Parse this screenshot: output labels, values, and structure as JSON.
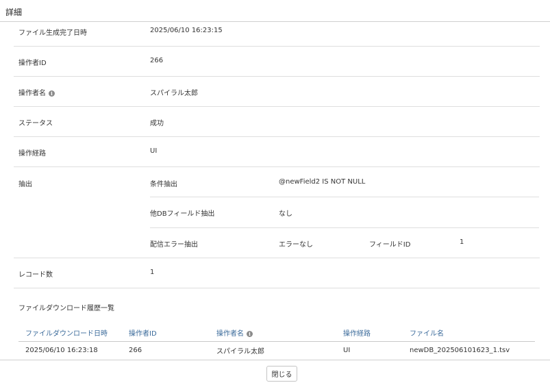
{
  "header": {
    "title": "詳細"
  },
  "details": {
    "file_generated": {
      "label": "ファイル生成完了日時",
      "value": "2025/06/10 16:23:15"
    },
    "operator_id": {
      "label": "操作者ID",
      "value": "266"
    },
    "operator_name": {
      "label": "操作者名",
      "value": "スパイラル太郎",
      "icon": "info-icon"
    },
    "status": {
      "label": "ステータス",
      "value": "成功"
    },
    "route": {
      "label": "操作経路",
      "value": "UI"
    },
    "extraction": {
      "label": "抽出",
      "condition": {
        "label": "条件抽出",
        "value": "@newField2 IS NOT NULL"
      },
      "other_db": {
        "label": "他DBフィールド抽出",
        "value": "なし"
      },
      "delivery_error": {
        "label": "配信エラー抽出",
        "value": "エラーなし",
        "field_label": "フィールドID",
        "field_value": "1"
      }
    },
    "record_count": {
      "label": "レコード数",
      "value": "1"
    }
  },
  "history": {
    "title": "ファイルダウンロード履歴一覧",
    "columns": [
      "ファイルダウンロード日時",
      "操作者ID",
      "操作者名",
      "操作経路",
      "ファイル名"
    ],
    "rows": [
      [
        "2025/06/10 16:23:18",
        "266",
        "スパイラル太郎",
        "UI",
        "newDB_202506101623_1.tsv"
      ]
    ]
  },
  "footer": {
    "close_label": "閉じる"
  },
  "colors": {
    "header_link": "#3a6a9a",
    "border": "#dedede",
    "info_icon": "#8a8a8a"
  }
}
